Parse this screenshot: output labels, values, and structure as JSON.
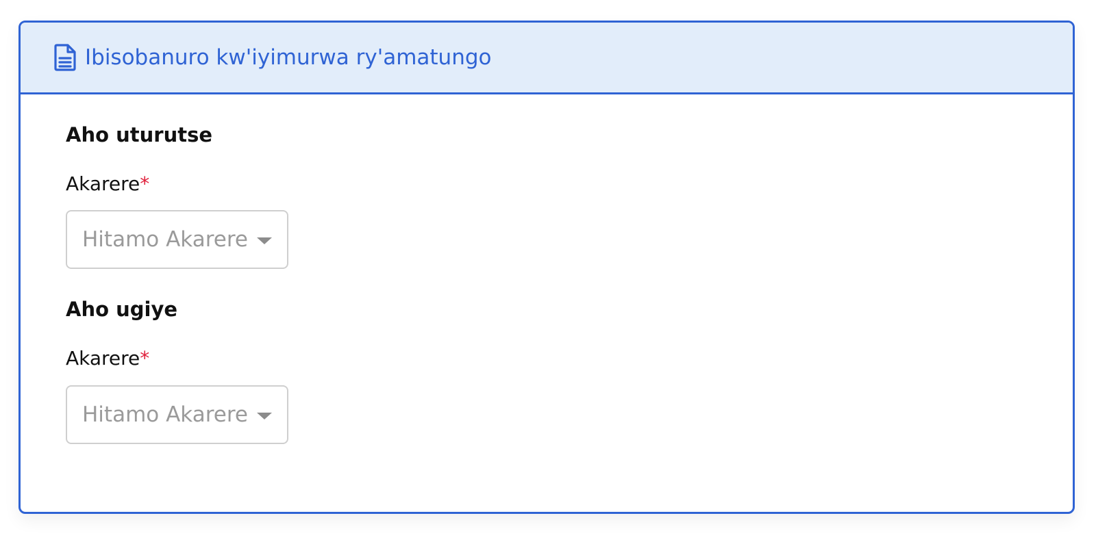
{
  "card": {
    "header": {
      "icon": "file-text-icon",
      "title": "Ibisobanuro kw'iyimurwa ry'amatungo"
    },
    "sections": [
      {
        "title": "Aho uturutse",
        "field": {
          "label": "Akarere",
          "required_marker": "*",
          "placeholder": "Hitamo Akarere"
        }
      },
      {
        "title": "Aho ugiye",
        "field": {
          "label": "Akarere",
          "required_marker": "*",
          "placeholder": "Hitamo Akarere"
        }
      }
    ]
  },
  "colors": {
    "accent": "#2f63d4",
    "header_background": "#e2edfa",
    "required": "#e0213c",
    "placeholder": "#9a9a9a"
  }
}
